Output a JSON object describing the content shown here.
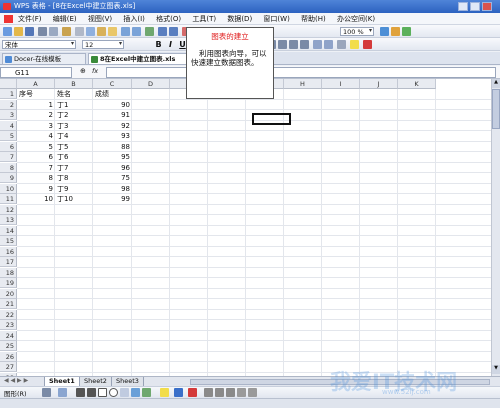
{
  "window": {
    "title": "WPS 表格 - [8在Excel中建立图表.xls]"
  },
  "menu": [
    "文件(F)",
    "编辑(E)",
    "视图(V)",
    "插入(I)",
    "格式(O)",
    "工具(T)",
    "数据(D)",
    "窗口(W)",
    "帮助(H)",
    "办公空间(K)"
  ],
  "toolbar": {
    "zoom": "100 %",
    "font_name": "宋体",
    "font_size": "12",
    "bold": "B",
    "italic": "I",
    "underline": "U"
  },
  "tabs": [
    {
      "label": "Docer-在线模板"
    },
    {
      "label": "8在Excel中建立图表.xls"
    }
  ],
  "formula_bar": {
    "name_box": "G11",
    "fx": "fx"
  },
  "columns": [
    "A",
    "B",
    "C",
    "D",
    "E",
    "F",
    "G",
    "H",
    "I",
    "J",
    "K"
  ],
  "rows": [
    "1",
    "2",
    "3",
    "4",
    "5",
    "6",
    "7",
    "8",
    "9",
    "10",
    "11",
    "12",
    "13",
    "14",
    "15",
    "16",
    "17",
    "18",
    "19",
    "20",
    "21",
    "22",
    "23",
    "24",
    "25",
    "26",
    "27",
    "28"
  ],
  "table": {
    "headers": [
      "序号",
      "姓名",
      "成绩"
    ],
    "rows": [
      [
        "1",
        "丁1",
        "90"
      ],
      [
        "2",
        "丁2",
        "91"
      ],
      [
        "3",
        "丁3",
        "92"
      ],
      [
        "4",
        "丁4",
        "93"
      ],
      [
        "5",
        "丁5",
        "88"
      ],
      [
        "6",
        "丁6",
        "95"
      ],
      [
        "7",
        "丁7",
        "96"
      ],
      [
        "8",
        "丁8",
        "75"
      ],
      [
        "9",
        "丁9",
        "98"
      ],
      [
        "10",
        "丁10",
        "99"
      ]
    ]
  },
  "textbox": {
    "title": "图表的建立",
    "body": "利用图表向导，可以快速建立数据图表。",
    "title_color": "#e02020"
  },
  "sheets": [
    "Sheet1",
    "Sheet2",
    "Sheet3"
  ],
  "drawing": {
    "label": "图形(R)"
  },
  "watermark": {
    "text": "我爱IT技术网",
    "sub": "www.52ij.com"
  }
}
